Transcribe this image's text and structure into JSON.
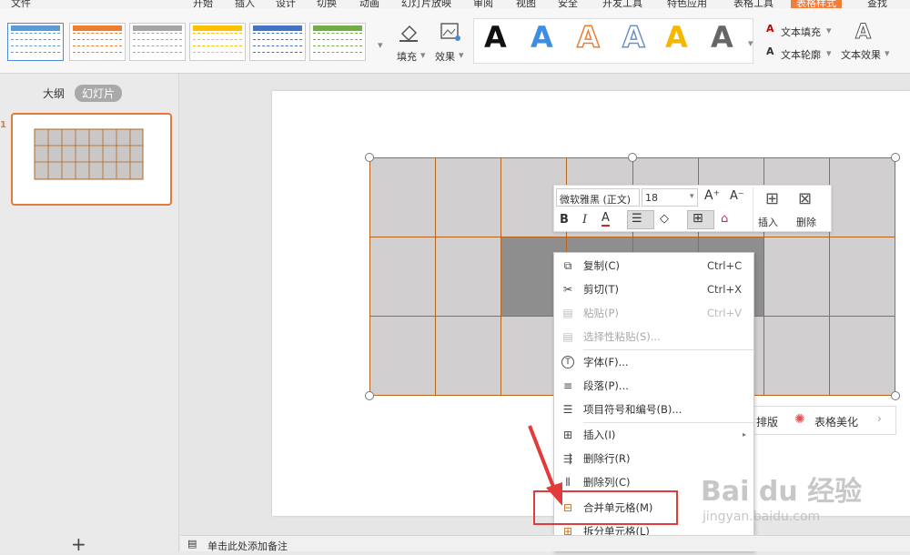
{
  "menu": {
    "file": "文件",
    "items": [
      "开始",
      "插入",
      "设计",
      "切换",
      "动画",
      "幻灯片放映",
      "审阅",
      "视图",
      "安全",
      "开发工具",
      "特色应用",
      "表格工具"
    ],
    "active": "表格样式",
    "search": "查找"
  },
  "ribbon": {
    "fill": "填充",
    "effect": "效果",
    "text_fill": "文本填充",
    "text_outline": "文本轮廓",
    "text_effect": "文本效果",
    "letter": "A"
  },
  "panel": {
    "outline_tab": "大纲",
    "slides_tab": "幻灯片",
    "slide_number": "1",
    "add": "+"
  },
  "mini_toolbar": {
    "font": "微软雅黑 (正文)",
    "size": "18",
    "bold": "B",
    "italic": "I",
    "insert": "插入",
    "delete": "删除"
  },
  "beautify": {
    "layout": "排版",
    "beautify": "表格美化"
  },
  "context_menu": [
    {
      "label": "复制(C)",
      "shortcut": "Ctrl+C",
      "icon": "copy-icon",
      "enabled": true
    },
    {
      "label": "剪切(T)",
      "shortcut": "Ctrl+X",
      "icon": "scissors-icon",
      "enabled": true
    },
    {
      "label": "粘贴(P)",
      "shortcut": "Ctrl+V",
      "icon": "paste-icon",
      "enabled": false
    },
    {
      "label": "选择性粘贴(S)...",
      "shortcut": "",
      "icon": "paste-special-icon",
      "enabled": false
    },
    {
      "label": "字体(F)...",
      "shortcut": "",
      "icon": "font-icon",
      "enabled": true
    },
    {
      "label": "段落(P)...",
      "shortcut": "",
      "icon": "paragraph-icon",
      "enabled": true
    },
    {
      "label": "项目符号和编号(B)...",
      "shortcut": "",
      "icon": "bullets-icon",
      "enabled": true
    },
    {
      "label": "插入(I)",
      "shortcut": "",
      "icon": "insert-table-icon",
      "enabled": true
    },
    {
      "label": "删除行(R)",
      "shortcut": "",
      "icon": "delete-row-icon",
      "enabled": true
    },
    {
      "label": "删除列(C)",
      "shortcut": "",
      "icon": "delete-column-icon",
      "enabled": true
    },
    {
      "label": "合并单元格(M)",
      "shortcut": "",
      "icon": "merge-cells-icon",
      "enabled": true
    },
    {
      "label": "拆分单元格(L)",
      "shortcut": "",
      "icon": "split-cells-icon",
      "enabled": true
    }
  ],
  "status": {
    "notes": "单击此处添加备注"
  },
  "watermark": {
    "brand": "Bai du 经验",
    "url": "jingyan.baidu.com"
  },
  "colors": {
    "accent": "#f27c3c",
    "table_border": "#b5651d",
    "highlight": "#e23b3b"
  }
}
